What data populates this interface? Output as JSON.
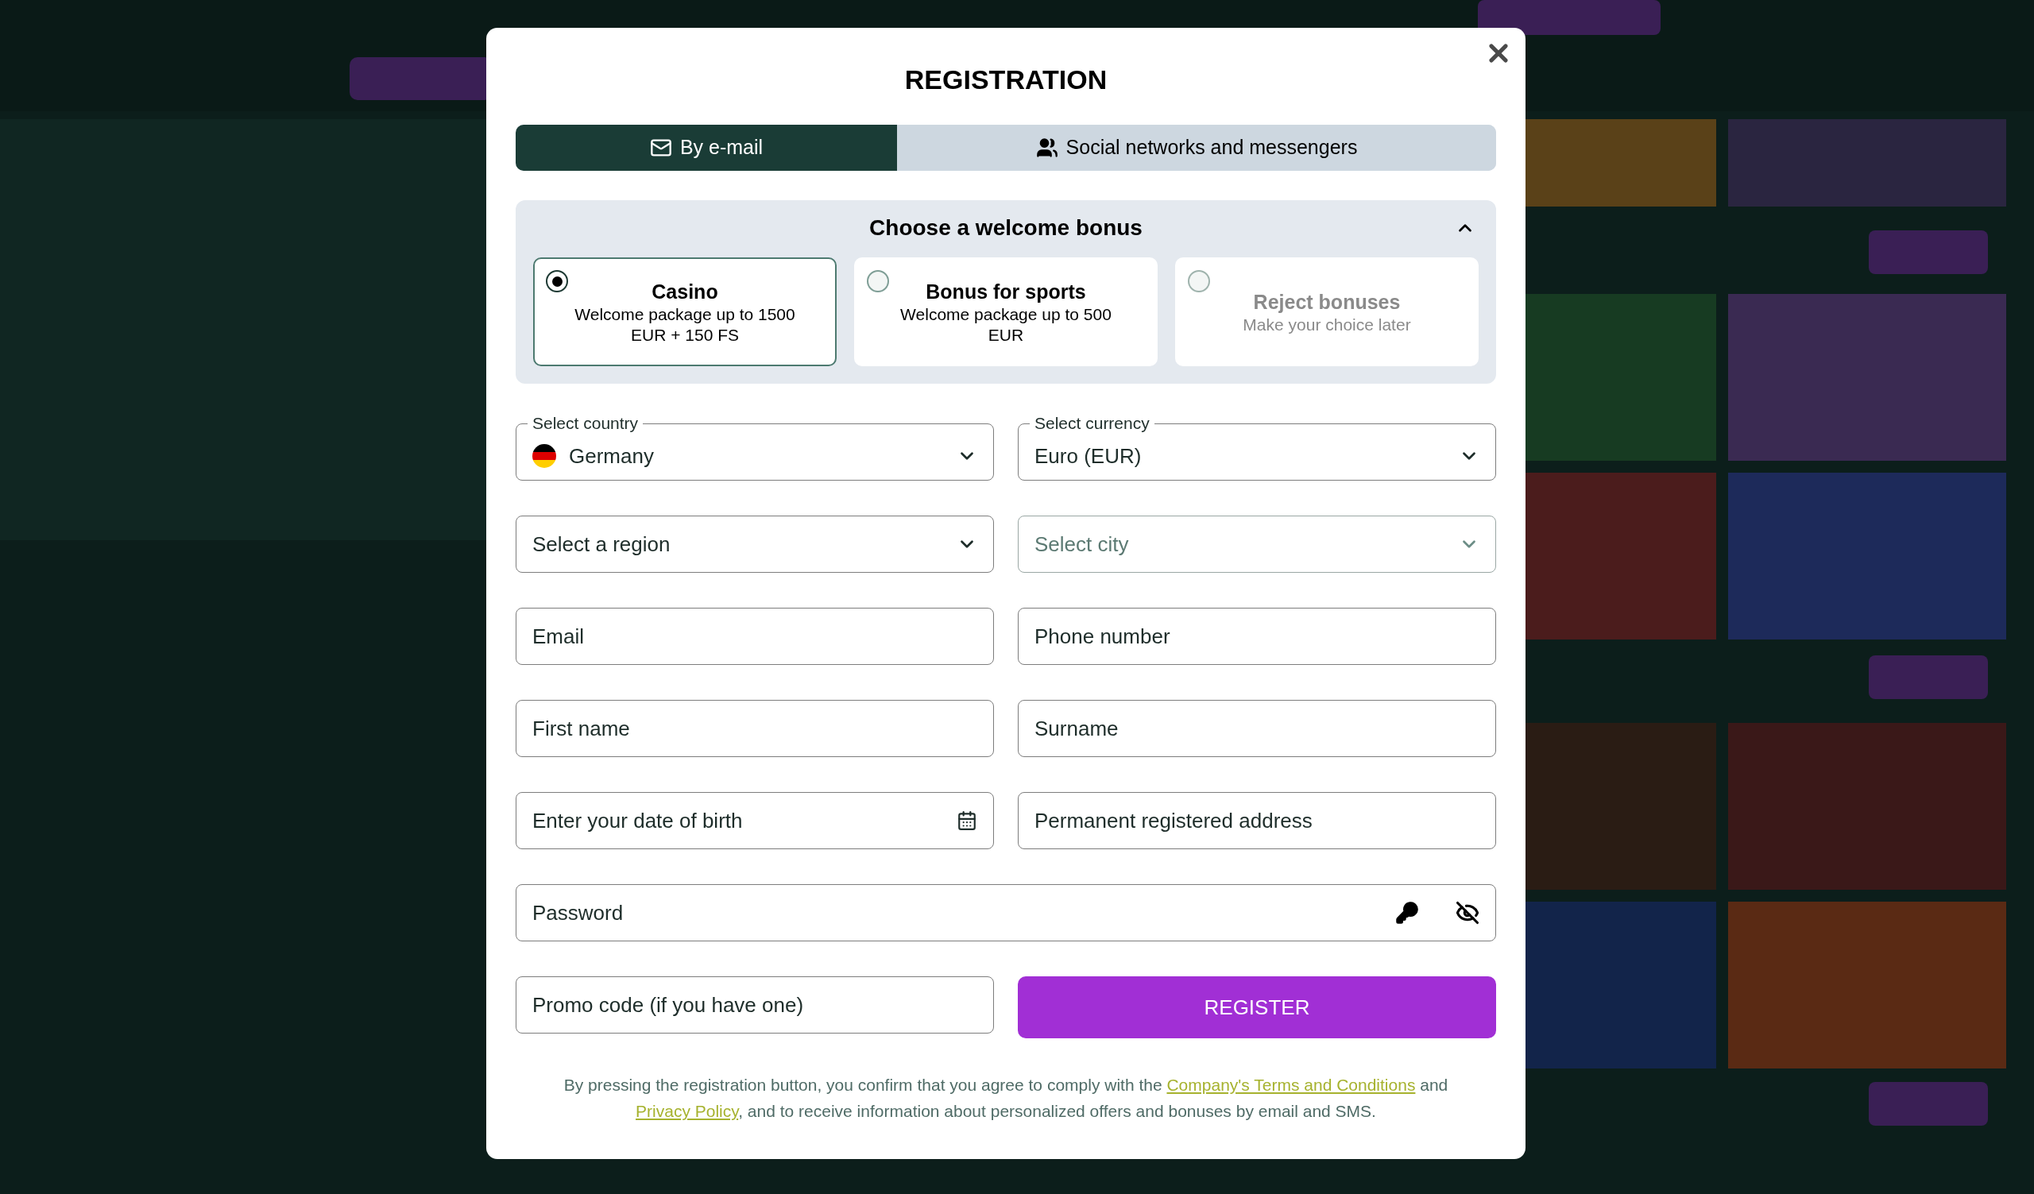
{
  "dialog": {
    "title": "REGISTRATION"
  },
  "tabs": [
    {
      "label": "By e-mail",
      "selected": true
    },
    {
      "label": "Social networks and messengers",
      "selected": false
    }
  ],
  "bonus": {
    "heading": "Choose a welcome bonus",
    "expanded": true,
    "options": [
      {
        "title": "Casino",
        "description": "Welcome package up to 1500 EUR + 150 FS",
        "selected": true,
        "disabled": false
      },
      {
        "title": "Bonus for sports",
        "description": "Welcome package up to 500 EUR",
        "selected": false,
        "disabled": false
      },
      {
        "title": "Reject bonuses",
        "description": "Make your choice later",
        "selected": false,
        "disabled": true
      }
    ]
  },
  "fields": [
    {
      "kind": "country-select",
      "label": "Select country",
      "value": "Germany",
      "disabled": false
    },
    {
      "kind": "select",
      "label": "Select currency",
      "value": "Euro (EUR)",
      "disabled": false
    },
    {
      "kind": "select",
      "placeholder": "Select a region",
      "disabled": false
    },
    {
      "kind": "select",
      "placeholder": "Select city",
      "disabled": true
    },
    {
      "kind": "text",
      "placeholder": "Email"
    },
    {
      "kind": "text",
      "placeholder": "Phone number"
    },
    {
      "kind": "text",
      "placeholder": "First name"
    },
    {
      "kind": "text",
      "placeholder": "Surname"
    },
    {
      "kind": "date",
      "placeholder": "Enter your date of birth"
    },
    {
      "kind": "text",
      "placeholder": "Permanent registered address"
    },
    {
      "kind": "password",
      "placeholder": "Password"
    },
    {
      "kind": "text",
      "placeholder": "Promo code (if you have one)"
    },
    {
      "kind": "button",
      "label": "REGISTER"
    }
  ],
  "consent": [
    {
      "kind": "text",
      "text": "By pressing the registration button, you confirm that you agree to comply with the "
    },
    {
      "kind": "link",
      "text": "Company's Terms and Conditions"
    },
    {
      "kind": "text",
      "text": " and "
    },
    {
      "kind": "link",
      "text": "Privacy Policy"
    },
    {
      "kind": "text",
      "text": ", and to receive information about personalized offers and bonuses by email and SMS."
    }
  ]
}
